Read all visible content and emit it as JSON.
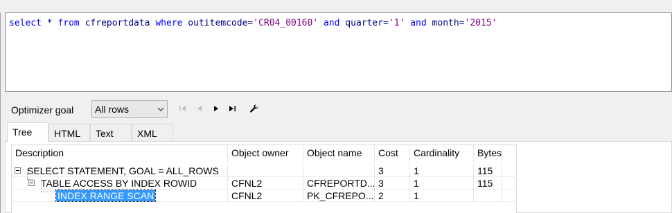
{
  "editor": {
    "sql_tokens": [
      {
        "t": "select",
        "c": "kw"
      },
      {
        "t": " * ",
        "c": "tx"
      },
      {
        "t": "from",
        "c": "kw"
      },
      {
        "t": " cfreportdata ",
        "c": "tx"
      },
      {
        "t": "where",
        "c": "kw"
      },
      {
        "t": " outitemcode=",
        "c": "tx"
      },
      {
        "t": "'CR04_00160'",
        "c": "st"
      },
      {
        "t": " ",
        "c": "tx"
      },
      {
        "t": "and",
        "c": "kw"
      },
      {
        "t": " quarter=",
        "c": "tx"
      },
      {
        "t": "'1'",
        "c": "st"
      },
      {
        "t": " ",
        "c": "tx"
      },
      {
        "t": "and",
        "c": "kw"
      },
      {
        "t": " month=",
        "c": "tx"
      },
      {
        "t": "'2015'",
        "c": "st"
      }
    ]
  },
  "toolbar": {
    "optimizer_label": "Optimizer goal",
    "optimizer_value": "All rows",
    "buttons": [
      "first-icon",
      "previous-icon",
      "next-icon",
      "last-icon",
      "wrench-icon"
    ]
  },
  "tabs": [
    {
      "label": "Tree",
      "active": true
    },
    {
      "label": "HTML",
      "active": false
    },
    {
      "label": "Text",
      "active": false
    },
    {
      "label": "XML",
      "active": false
    }
  ],
  "grid": {
    "columns": [
      "Description",
      "Object owner",
      "Object name",
      "Cost",
      "Cardinality",
      "Bytes"
    ],
    "rows": [
      {
        "description": "SELECT STATEMENT, GOAL = ALL_ROWS",
        "owner": "",
        "name": "",
        "cost": "3",
        "cardinality": "1",
        "bytes": "115"
      },
      {
        "description": "TABLE ACCESS BY INDEX ROWID",
        "owner": "CFNL2",
        "name": "CFREPORTD...",
        "cost": "3",
        "cardinality": "1",
        "bytes": "115"
      },
      {
        "description": "INDEX RANGE SCAN",
        "owner": "CFNL2",
        "name": "PK_CFREPO...",
        "cost": "2",
        "cardinality": "1",
        "bytes": ""
      }
    ]
  },
  "colors": {
    "keyword": "#0000ff",
    "identifier": "#000080",
    "string": "#800080",
    "selection": "#3399ff"
  }
}
